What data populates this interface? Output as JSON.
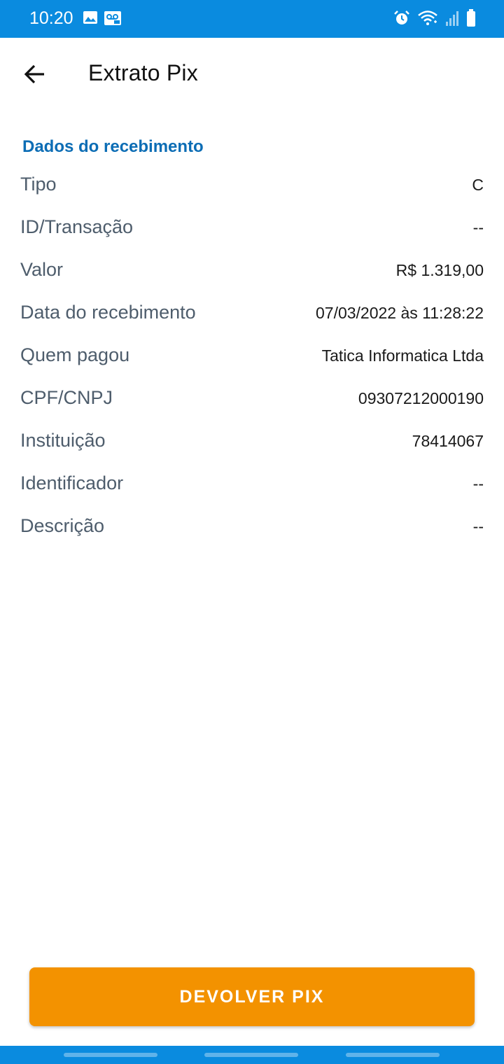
{
  "status_bar": {
    "time": "10:20",
    "left_icons": [
      "image-icon",
      "voicemail-icon"
    ],
    "right_icons": [
      "alarm-icon",
      "wifi-icon",
      "signal-icon",
      "battery-icon"
    ],
    "color": "#0a8bdf"
  },
  "header": {
    "title": "Extrato Pix",
    "back_icon": "arrow-left-icon"
  },
  "section": {
    "title": "Dados do recebimento",
    "color": "#0c6db5"
  },
  "details": [
    {
      "label": "Tipo",
      "value": "C"
    },
    {
      "label": "ID/Transação",
      "value": "--"
    },
    {
      "label": "Valor",
      "value": "R$ 1.319,00"
    },
    {
      "label": "Data do recebimento",
      "value": "07/03/2022 às 11:28:22"
    },
    {
      "label": "Quem pagou",
      "value": "Tatica Informatica Ltda"
    },
    {
      "label": "CPF/CNPJ",
      "value": "09307212000190"
    },
    {
      "label": "Instituição",
      "value": "78414067"
    },
    {
      "label": "Identificador",
      "value": "--"
    },
    {
      "label": "Descrição",
      "value": "--"
    }
  ],
  "action": {
    "label": "DEVOLVER PIX",
    "color": "#f39200"
  }
}
